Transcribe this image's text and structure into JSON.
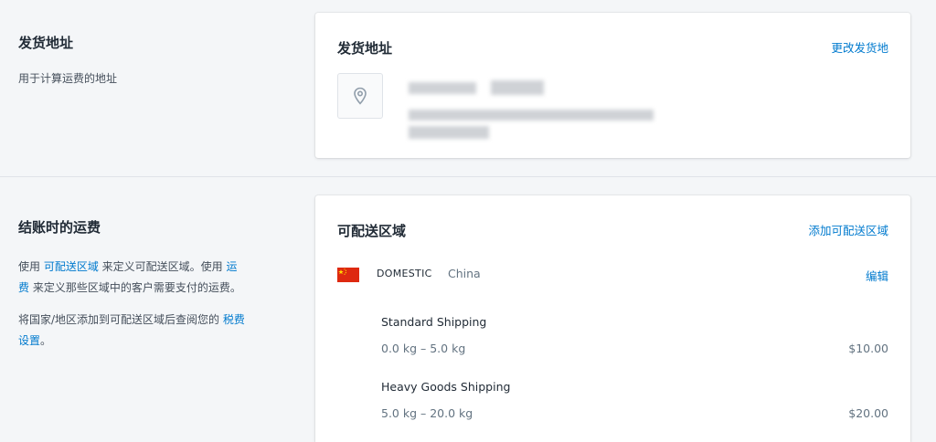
{
  "origin": {
    "aside_title": "发货地址",
    "aside_desc": "用于计算运费的地址",
    "card_title": "发货地址",
    "change_link": "更改发货地"
  },
  "rates": {
    "aside_title": "结账时的运费",
    "p1_a": "使用 ",
    "p1_link1": "可配送区域",
    "p1_b": " 来定义可配送区域。使用 ",
    "p1_link2": "运费",
    "p1_c": " 来定义那些区域中的客户需要支付的运费。",
    "p2_a": "将国家/地区添加到可配送区域后查阅您的 ",
    "p2_link": "税费设置",
    "p2_b": "。",
    "card_title": "可配送区域",
    "add_link": "添加可配送区域",
    "zone": {
      "name": "DOMESTIC",
      "country": "China",
      "edit_label": "编辑",
      "flag_icon": "china-flag-icon"
    },
    "shipping_rates": [
      {
        "name": "Standard Shipping",
        "range": "0.0 kg – 5.0 kg",
        "price": "$10.00"
      },
      {
        "name": "Heavy Goods Shipping",
        "range": "5.0 kg – 20.0 kg",
        "price": "$20.00"
      }
    ]
  },
  "colors": {
    "accent": "#007ace",
    "page_bg": "#f4f6f8",
    "flag_red": "#de2910",
    "flag_yellow": "#ffde00"
  },
  "icons": {
    "address": "location-pin-icon"
  }
}
